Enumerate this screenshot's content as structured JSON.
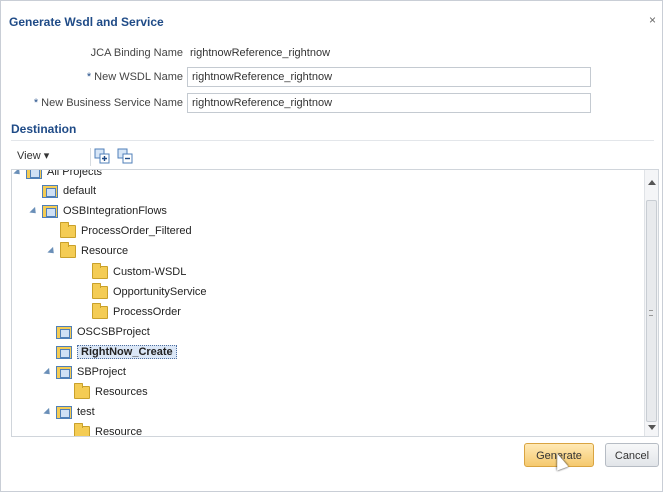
{
  "dialog": {
    "title": "Generate Wsdl and Service",
    "close_glyph": "×"
  },
  "form": {
    "jca_label": "JCA Binding Name",
    "jca_value": "rightnowReference_rightnow",
    "wsdl_label": "New WSDL Name",
    "wsdl_value": "rightnowReference_rightnow",
    "biz_label": "New Business Service Name",
    "biz_value": "rightnowReference_rightnow",
    "required_mark": "*"
  },
  "destination": {
    "section_label": "Destination",
    "view_label": "View ▾",
    "tree": [
      {
        "label": "All Projects",
        "type": "project"
      },
      {
        "label": "default",
        "type": "project"
      },
      {
        "label": "OSBIntegrationFlows",
        "type": "project"
      },
      {
        "label": "ProcessOrder_Filtered",
        "type": "folder"
      },
      {
        "label": "Resource",
        "type": "folder"
      },
      {
        "label": "Custom-WSDL",
        "type": "folder"
      },
      {
        "label": "OpportunityService",
        "type": "folder"
      },
      {
        "label": "ProcessOrder",
        "type": "folder"
      },
      {
        "label": "OSCSBProject",
        "type": "project"
      },
      {
        "label": "RightNow_Create",
        "type": "project",
        "selected": true
      },
      {
        "label": "SBProject",
        "type": "project"
      },
      {
        "label": "Resources",
        "type": "folder"
      },
      {
        "label": "test",
        "type": "project"
      },
      {
        "label": "Resource",
        "type": "folder"
      }
    ]
  },
  "buttons": {
    "generate": "Generate",
    "cancel": "Cancel"
  },
  "icons": {
    "expand_all": "expand-all-icon",
    "collapse_all": "collapse-all-icon"
  },
  "colors": {
    "accent": "#1f4b87",
    "primary_button": "#f5c96e",
    "selection": "#dbe7f7"
  }
}
